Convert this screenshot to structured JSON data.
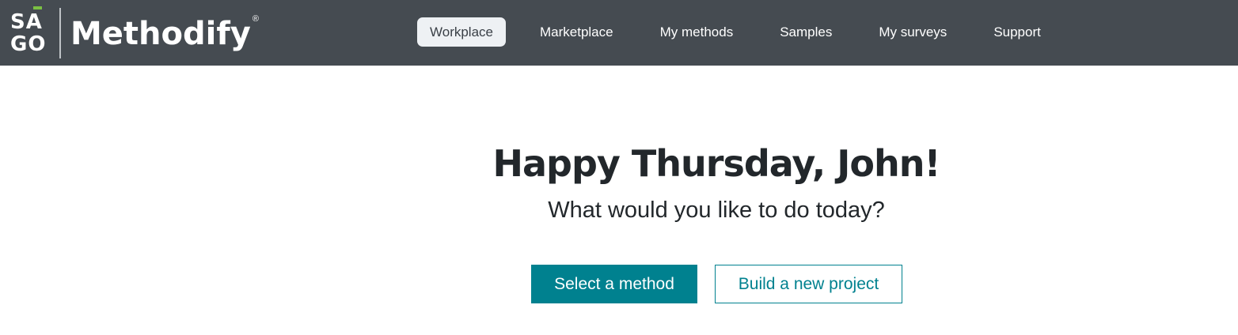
{
  "header": {
    "logo": {
      "line1": "SA",
      "line2": "GO",
      "wordmark": "Methodify",
      "registered": "®"
    },
    "nav": [
      {
        "label": "Workplace",
        "active": true
      },
      {
        "label": "Marketplace",
        "active": false
      },
      {
        "label": "My methods",
        "active": false
      },
      {
        "label": "Samples",
        "active": false
      },
      {
        "label": "My surveys",
        "active": false
      },
      {
        "label": "Support",
        "active": false
      }
    ]
  },
  "main": {
    "greeting": "Happy Thursday, John!",
    "subtitle": "What would you like to do today?",
    "primary_button": "Select a method",
    "secondary_button": "Build a new project"
  },
  "colors": {
    "header_bg": "#454b51",
    "accent": "#00818f",
    "logo_accent": "#7bc043"
  }
}
